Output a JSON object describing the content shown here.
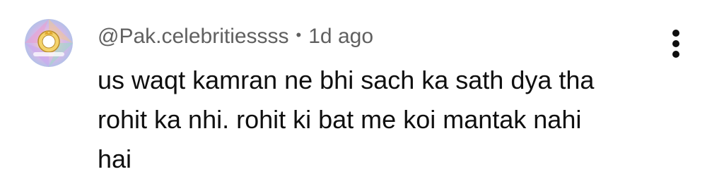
{
  "comment": {
    "author": "@Pak.celebritiessss",
    "separator": "•",
    "timestamp": "1d ago",
    "text_lines": [
      "us waqt kamran ne bhi sach ka sath dya tha",
      "rohit ka nhi. rohit ki bat me koi mantak nahi",
      "hai"
    ],
    "avatar_icon": "celebrity-logo-avatar",
    "menu_icon": "more-vertical-icon"
  },
  "colors": {
    "meta_text": "#606060",
    "body_text": "#0f0f0f",
    "background": "#ffffff"
  }
}
